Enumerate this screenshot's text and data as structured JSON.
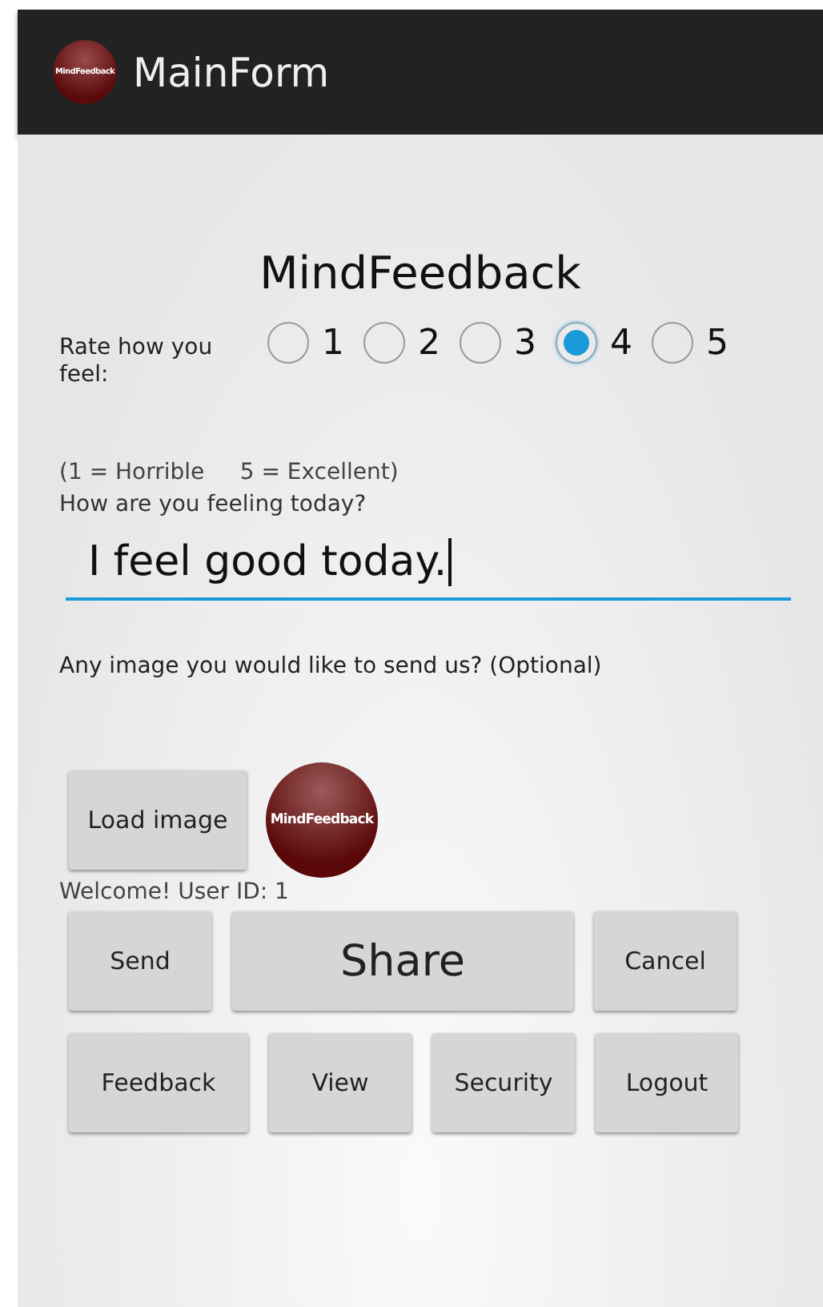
{
  "app_bar": {
    "logo_text": "MindFeedback",
    "title": "MainForm"
  },
  "heading": "MindFeedback",
  "rating": {
    "label": "Rate how you feel:",
    "options": [
      {
        "label": "1",
        "selected": false
      },
      {
        "label": "2",
        "selected": false
      },
      {
        "label": "3",
        "selected": false
      },
      {
        "label": "4",
        "selected": true
      },
      {
        "label": "5",
        "selected": false
      }
    ]
  },
  "scale_hint": "(1 = Horrible     5 = Excellent)",
  "feeling": {
    "label": "How are you feeling today?",
    "value": "I feel good today."
  },
  "image_prompt": "Any image you would like to send us? (Optional)",
  "load_button": "Load image",
  "image_logo_text": "MindFeedback",
  "welcome": "Welcome! User ID: 1",
  "actions": [
    {
      "label": "Send",
      "kind": "normal"
    },
    {
      "label": "Share",
      "kind": "large"
    },
    {
      "label": "Cancel",
      "kind": "normal"
    }
  ],
  "nav_buttons": [
    "Feedback",
    "View",
    "Security",
    "Logout"
  ]
}
